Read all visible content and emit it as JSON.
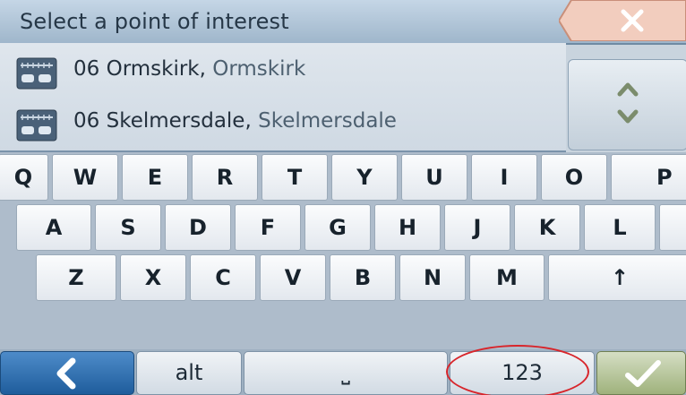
{
  "header": {
    "title": "Select a point of interest",
    "close_icon": "close-icon"
  },
  "results": [
    {
      "number": "06",
      "name": "Ormskirk,",
      "town": "Ormskirk",
      "icon": "poi-icon"
    },
    {
      "number": "06",
      "name": "Skelmersdale,",
      "town": "Skelmersdale",
      "icon": "poi-icon"
    }
  ],
  "scroll": {
    "icon": "scroll-up-down-icon"
  },
  "keyboard": {
    "row1": [
      "Q",
      "W",
      "E",
      "R",
      "T",
      "Y",
      "U",
      "I",
      "O",
      "P"
    ],
    "row2": [
      "A",
      "S",
      "D",
      "F",
      "G",
      "H",
      "J",
      "K",
      "L"
    ],
    "row3": [
      "Z",
      "X",
      "C",
      "V",
      "B",
      "N",
      "M",
      "↑"
    ]
  },
  "bottom": {
    "back_icon": "chevron-left-icon",
    "alt_label": "alt",
    "space_label": "⎵",
    "numbers_label": "123",
    "done_icon": "checkmark-icon"
  },
  "colors": {
    "header": "#b4c7d9",
    "close_accent": "#e9b6a6",
    "back_button": "#2f6fb0",
    "ok_button": "#b3c392",
    "highlight_circle": "#d8252b"
  }
}
